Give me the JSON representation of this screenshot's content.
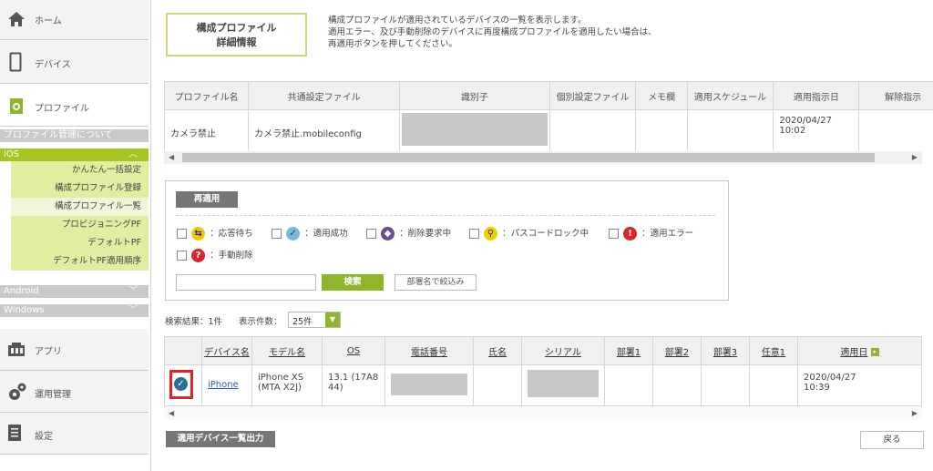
{
  "sidebar": {
    "home": "ホーム",
    "device": "デバイス",
    "profile": "プロファイル",
    "profile_about": "プロファイル管理について",
    "ios": "iOS",
    "ios_items": [
      "かんたん一括設定",
      "構成プロファイル登録",
      "構成プロファイル一覧",
      "プロビジョニングPF",
      "デフォルトPF",
      "デフォルトPF適用順序"
    ],
    "android": "Android",
    "windows": "Windows",
    "apps": "アプリ",
    "operations": "運用管理",
    "settings": "設定"
  },
  "detail_button": {
    "line1": "構成プロファイル",
    "line2": "詳細情報"
  },
  "description": [
    "構成プロファイルが適用されているデバイスの一覧を表示します。",
    "適用エラー、及び手動削除のデバイスに再度構成プロファイルを適用したい場合は、",
    "再適用ボタンを押してください。"
  ],
  "profile_table": {
    "headers": [
      "プロファイル名",
      "共通設定ファイル",
      "識別子",
      "個別設定ファイル",
      "メモ欄",
      "適用スケジュール",
      "適用指示日",
      "解除指示"
    ],
    "row": {
      "name": "カメラ禁止",
      "common_file": "カメラ禁止.mobileconfig",
      "identifier": "",
      "individual_file": "",
      "memo": "",
      "schedule": "",
      "apply_date": "2020/04/27",
      "apply_time": "10:02",
      "release": ""
    }
  },
  "filter": {
    "reapply_button": "再適用",
    "statuses": [
      {
        "label": "：応答待ち",
        "icon": "arrows-exchange-icon",
        "color": "#f0c419"
      },
      {
        "label": "：適用成功",
        "icon": "check-icon",
        "color": "#7ab8d8"
      },
      {
        "label": "：削除要求中",
        "icon": "delete-request-icon",
        "color": "#6a4c93"
      },
      {
        "label": "：パスコードロック中",
        "icon": "keyhole-icon",
        "color": "#f0d000"
      },
      {
        "label": "：適用エラー",
        "icon": "exclamation-icon",
        "color": "#d9242b"
      },
      {
        "label": "：手動削除",
        "icon": "question-icon",
        "color": "#d9242b"
      }
    ],
    "search_value": "",
    "search_button": "検索",
    "dept_filter_button": "部署名で絞込み"
  },
  "results": {
    "count_label": "検索結果：1件",
    "per_page_label": "表示件数：",
    "per_page_value": "25件"
  },
  "device_table": {
    "headers": [
      "デバイス名",
      "モデル名",
      "OS",
      "電話番号",
      "氏名",
      "シリアル",
      "部署1",
      "部署2",
      "部署3",
      "任意1",
      "適用日"
    ],
    "row": {
      "device_name": "iPhone",
      "model": "iPhone XS (MTA X2J)",
      "os": "13.1 (17A8 44)",
      "phone": "",
      "name": "",
      "serial": "",
      "dept1": "",
      "dept2": "",
      "dept3": "",
      "any1": "",
      "apply_date": "2020/04/27",
      "apply_time": "10:39"
    }
  },
  "export_button": "適用デバイス一覧出力",
  "back_button": "戻る",
  "colors": {
    "accent_green": "#a6c520",
    "highlight_red": "#e0252a"
  }
}
